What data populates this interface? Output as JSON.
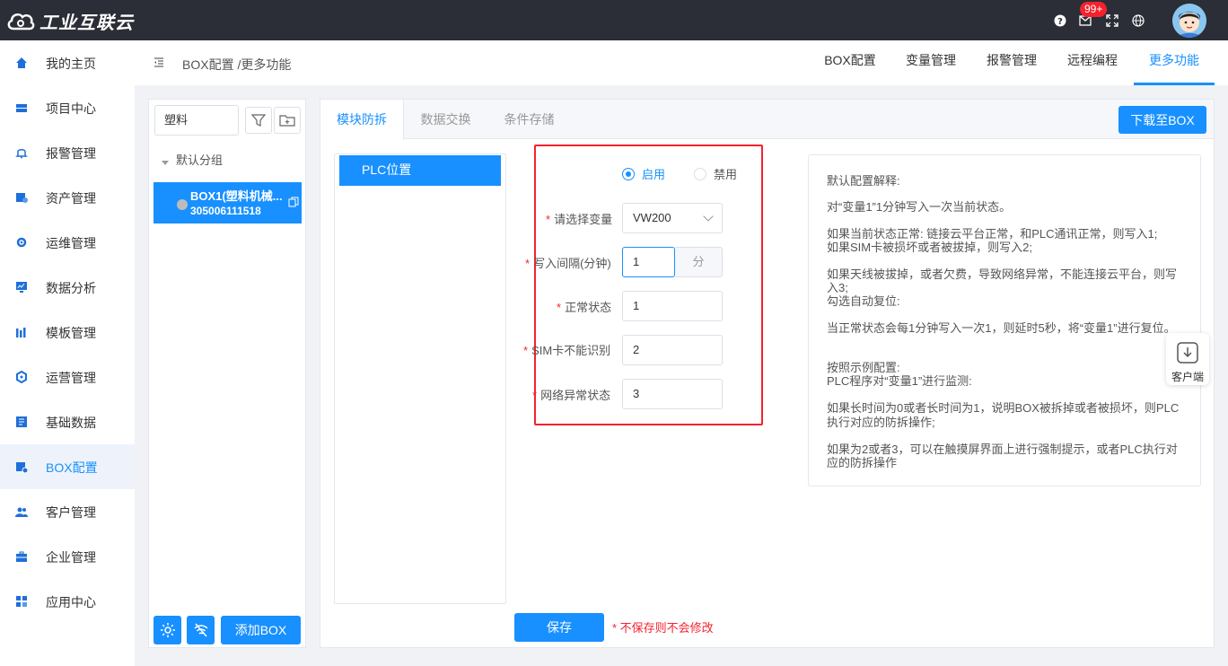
{
  "app": {
    "logo_text": "工业互联云",
    "notification_count": "99+"
  },
  "sidebar": {
    "items": [
      {
        "label": "我的主页",
        "icon": "home-icon"
      },
      {
        "label": "项目中心",
        "icon": "project-icon"
      },
      {
        "label": "报警管理",
        "icon": "bell-icon"
      },
      {
        "label": "资产管理",
        "icon": "asset-icon"
      },
      {
        "label": "运维管理",
        "icon": "gear-icon"
      },
      {
        "label": "数据分析",
        "icon": "monitor-chart-icon"
      },
      {
        "label": "模板管理",
        "icon": "bar-chart-icon"
      },
      {
        "label": "运营管理",
        "icon": "cog-icon"
      },
      {
        "label": "基础数据",
        "icon": "book-icon"
      },
      {
        "label": "BOX配置",
        "icon": "box-config-icon",
        "active": true
      },
      {
        "label": "客户管理",
        "icon": "users-icon"
      },
      {
        "label": "企业管理",
        "icon": "briefcase-icon"
      },
      {
        "label": "应用中心",
        "icon": "apps-icon"
      }
    ]
  },
  "header": {
    "breadcrumb": "BOX配置 /更多功能",
    "tabs": [
      "BOX配置",
      "变量管理",
      "报警管理",
      "远程编程",
      "更多功能"
    ],
    "active_tab": "更多功能"
  },
  "tree": {
    "search_value": "塑料",
    "group_label": "默认分组",
    "box_name": "BOX1(塑料机械...",
    "box_id": "305006111518",
    "add_box_label": "添加BOX"
  },
  "content_tabs": {
    "tabs": [
      "模块防拆",
      "数据交换",
      "条件存储"
    ],
    "active": "模块防拆",
    "download_label": "下载至BOX"
  },
  "list": {
    "item": "PLC位置"
  },
  "form": {
    "enable_label": "启用",
    "disable_label": "禁用",
    "enabled": true,
    "variable_label": "请选择变量",
    "variable_value": "VW200",
    "interval_label": "写入间隔(分钟)",
    "interval_value": "1",
    "interval_unit": "分",
    "normal_label": "正常状态",
    "normal_value": "1",
    "sim_label": "SIM卡不能识别",
    "sim_value": "2",
    "network_label": "网络异常状态",
    "network_value": "3",
    "required_mark": "*"
  },
  "explain": {
    "lines": [
      "默认配置解释:",
      "对“变量1”1分钟写入一次当前状态。",
      "如果当前状态正常: 链接云平台正常，和PLC通讯正常，则写入1;",
      "如果SIM卡被损坏或者被拔掉，则写入2;",
      "如果天线被拔掉，或者欠费，导致网络异常，不能连接云平台，则写",
      "入3;",
      "勾选自动复位:",
      "当正常状态会每1分钟写入一次1，则延时5秒，将“变量1”进行复位。",
      "按照示例配置:",
      "PLC程序对“变量1”进行监测:",
      "如果长时间为0或者长时间为1，说明BOX被拆掉或者被损坏，则PLC",
      "执行对应的防拆操作;",
      "如果为2或者3，可以在触摸屏界面上进行强制提示，或者PLC执行对",
      "应的防拆操作"
    ]
  },
  "footer": {
    "save_label": "保存",
    "save_note": "* 不保存则不会修改"
  },
  "client_float": {
    "label": "客户端"
  },
  "colors": {
    "primary": "#1890ff",
    "topbar": "#2b2e36",
    "danger": "#f5222d"
  }
}
